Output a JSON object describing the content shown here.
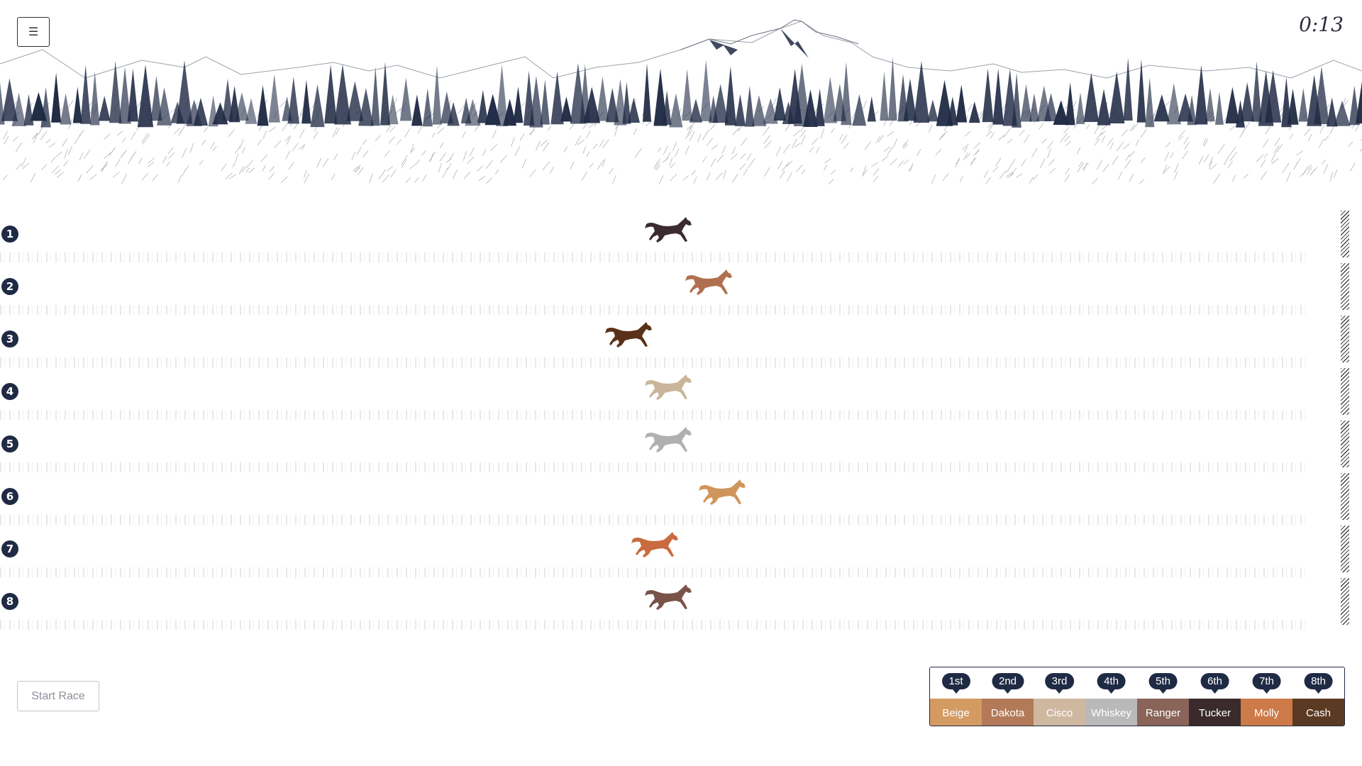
{
  "menu": {
    "icon": "☰"
  },
  "timer": "0:13",
  "start_button": "Start Race",
  "lanes": [
    {
      "number": "1",
      "color": "#3b2a30",
      "progress": 0.48
    },
    {
      "number": "2",
      "color": "#b07050",
      "progress": 0.51
    },
    {
      "number": "3",
      "color": "#5a3018",
      "progress": 0.45
    },
    {
      "number": "4",
      "color": "#cbb59a",
      "progress": 0.48
    },
    {
      "number": "5",
      "color": "#b0b0b0",
      "progress": 0.48
    },
    {
      "number": "6",
      "color": "#d0955a",
      "progress": 0.52
    },
    {
      "number": "7",
      "color": "#c86b3e",
      "progress": 0.47
    },
    {
      "number": "8",
      "color": "#7a5248",
      "progress": 0.48
    }
  ],
  "standings": [
    {
      "place": "1st",
      "name": "Beige",
      "color": "#d39a62"
    },
    {
      "place": "2nd",
      "name": "Dakota",
      "color": "#b27a58"
    },
    {
      "place": "3rd",
      "name": "Cisco",
      "color": "#cfb8a0"
    },
    {
      "place": "4th",
      "name": "Whiskey",
      "color": "#b9b9b9"
    },
    {
      "place": "5th",
      "name": "Ranger",
      "color": "#8a6458"
    },
    {
      "place": "6th",
      "name": "Tucker",
      "color": "#3a2a2c"
    },
    {
      "place": "7th",
      "name": "Molly",
      "color": "#cc7a48"
    },
    {
      "place": "8th",
      "name": "Cash",
      "color": "#5a3a22"
    }
  ]
}
